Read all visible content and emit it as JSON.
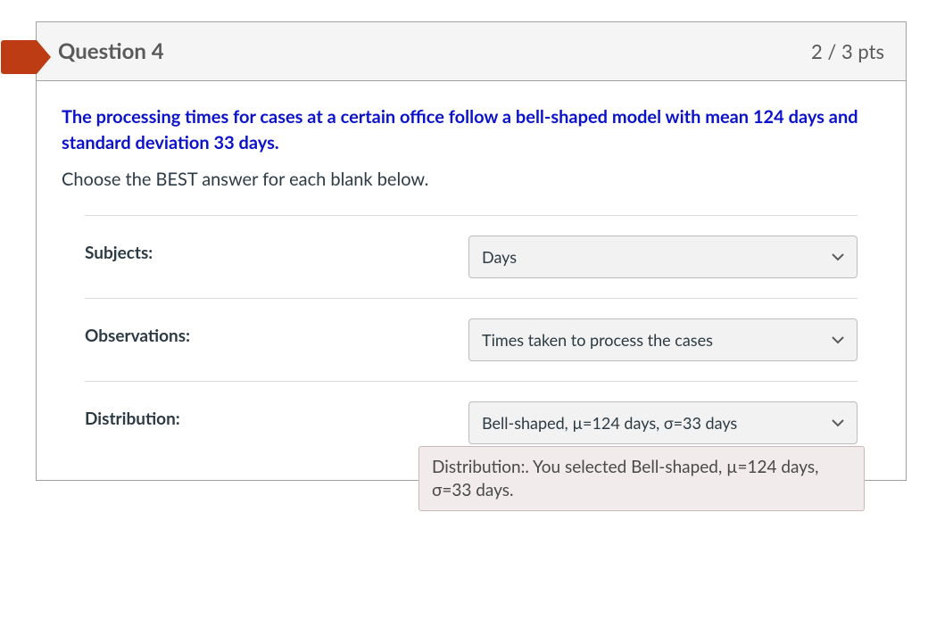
{
  "header": {
    "title": "Question 4",
    "points": "2 / 3 pts"
  },
  "prompt": {
    "bold": "The processing times for cases at a certain office follow a bell-shaped model with mean 124 days and standard deviation 33 days.",
    "sub": "Choose the BEST answer for each blank below."
  },
  "rows": {
    "subjects": {
      "label": "Subjects:",
      "value": "Days"
    },
    "observations": {
      "label": "Observations:",
      "value": "Times taken to process the cases"
    },
    "distribution": {
      "label": "Distribution:",
      "value": "Bell-shaped, µ=124 days, σ=33 days"
    }
  },
  "tooltip": "Distribution:. You selected Bell-shaped, µ=124 days, σ=33 days."
}
